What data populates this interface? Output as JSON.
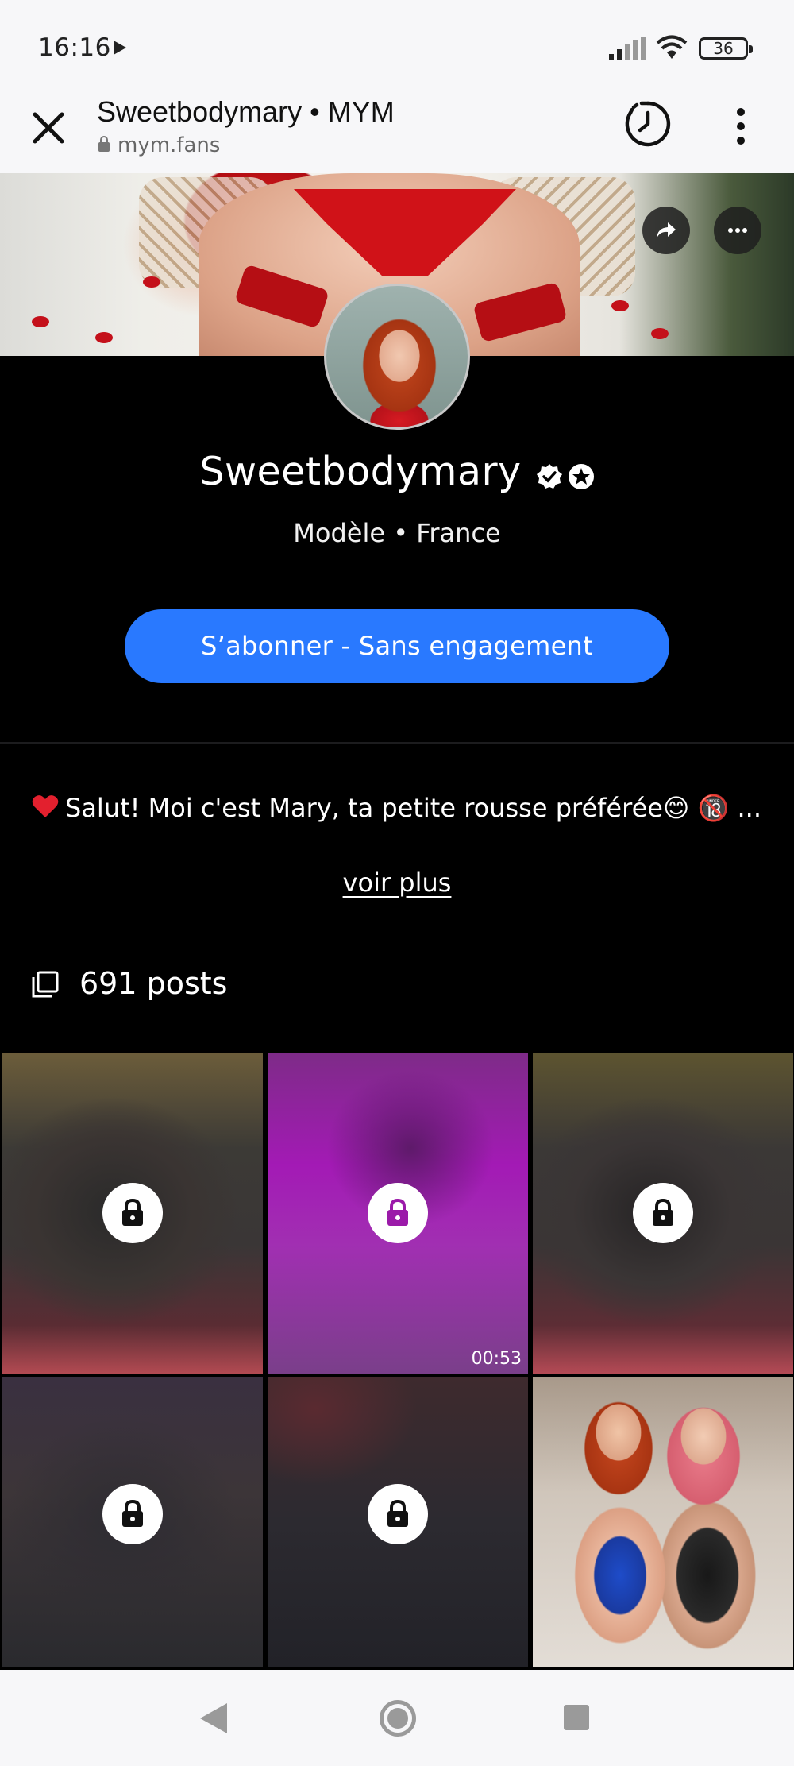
{
  "status_bar": {
    "time": "16:16",
    "battery": "36"
  },
  "browser": {
    "title": "Sweetbodymary • MYM",
    "url": "mym.fans"
  },
  "profile": {
    "name": "Sweetbodymary",
    "subtitle": "Modèle • France",
    "subscribe_label": "S’abonner - Sans engagement",
    "bio": "Salut! Moi c'est Mary, ta petite rousse préférée😊 🔞 ...",
    "see_more_label": "voir plus",
    "posts_count": "691 posts"
  },
  "grid": {
    "tiles": [
      {
        "locked": true,
        "duration": ""
      },
      {
        "locked": true,
        "duration": "00:53"
      },
      {
        "locked": true,
        "duration": ""
      },
      {
        "locked": true,
        "duration": ""
      },
      {
        "locked": true,
        "duration": ""
      },
      {
        "locked": false,
        "duration": ""
      }
    ]
  },
  "colors": {
    "accent": "#2979ff",
    "background": "#000000",
    "bars": "#f7f7f9"
  },
  "icons": [
    "close-icon",
    "lock-icon",
    "history-icon",
    "more-vert-icon",
    "share-icon",
    "more-horiz-icon",
    "verified-icon",
    "star-icon",
    "heart-icon",
    "posts-icon"
  ]
}
